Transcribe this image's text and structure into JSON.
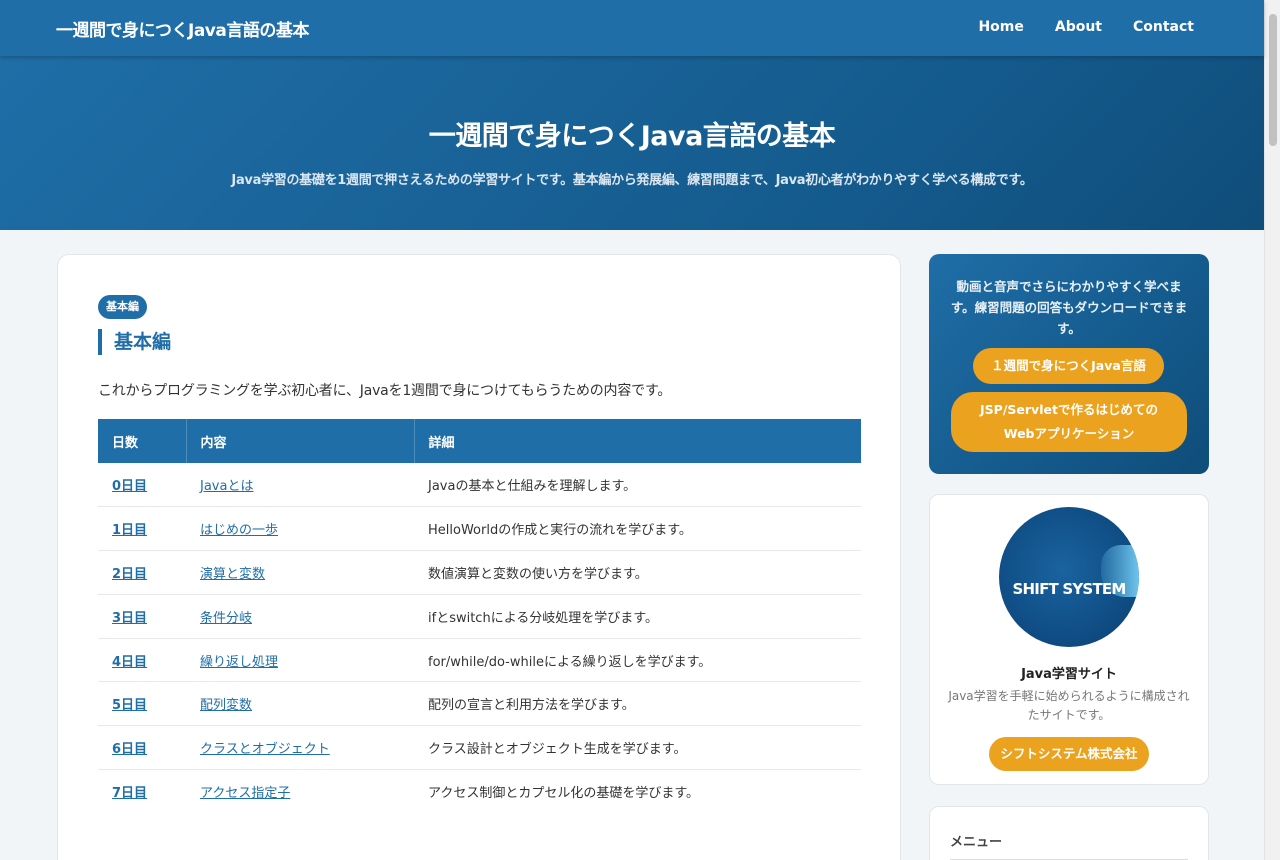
{
  "nav": {
    "brand": "一週間で身につくJava言語の基本",
    "links": [
      "Home",
      "About",
      "Contact"
    ]
  },
  "hero": {
    "title": "一週間で身につくJava言語の基本",
    "subtitle": "Java学習の基礎を1週間で押さえるための学習サイトです。基本編から発展編、練習問題まで、Java初心者がわかりやすく学べる構成です。"
  },
  "main": {
    "badge": "基本編",
    "heading": "基本編",
    "description": "これからプログラミングを学ぶ初心者に、Javaを1週間で身につけてもらうための内容です。",
    "table": {
      "headers": [
        "日数",
        "内容",
        "詳細"
      ],
      "rows": [
        {
          "day": "0日目",
          "topic": "Javaとは",
          "detail": "Javaの基本と仕組みを理解します。"
        },
        {
          "day": "1日目",
          "topic": "はじめの一歩",
          "detail": "HelloWorldの作成と実行の流れを学びます。"
        },
        {
          "day": "2日目",
          "topic": "演算と変数",
          "detail": "数値演算と変数の使い方を学びます。"
        },
        {
          "day": "3日目",
          "topic": "条件分岐",
          "detail": "ifとswitchによる分岐処理を学びます。"
        },
        {
          "day": "4日目",
          "topic": "繰り返し処理",
          "detail": "for/while/do-whileによる繰り返しを学びます。"
        },
        {
          "day": "5日目",
          "topic": "配列変数",
          "detail": "配列の宣言と利用方法を学びます。"
        },
        {
          "day": "6日目",
          "topic": "クラスとオブジェクト",
          "detail": "クラス設計とオブジェクト生成を学びます。"
        },
        {
          "day": "7日目",
          "topic": "アクセス指定子",
          "detail": "アクセス制御とカプセル化の基礎を学びます。"
        }
      ]
    }
  },
  "sidebar": {
    "promo": {
      "text": "動画と音声でさらにわかりやすく学べます。練習問題の回答もダウンロードできます。",
      "button1": "１週間で身につくJava言語",
      "button2_line1": "JSP/Servletで作るはじめての",
      "button2_line2": "Webアプリケーション"
    },
    "profile": {
      "logo_text": "SHIFT SYSTEM",
      "name": "Java学習サイト",
      "description": "Java学習を手軽に始められるように構成されたサイトです。",
      "button": "シフトシステム株式会社"
    },
    "menu": {
      "title": "メニュー"
    }
  },
  "colors": {
    "primary": "#1f6ea7",
    "accent": "#eba21e",
    "background": "#f2f5f8"
  }
}
